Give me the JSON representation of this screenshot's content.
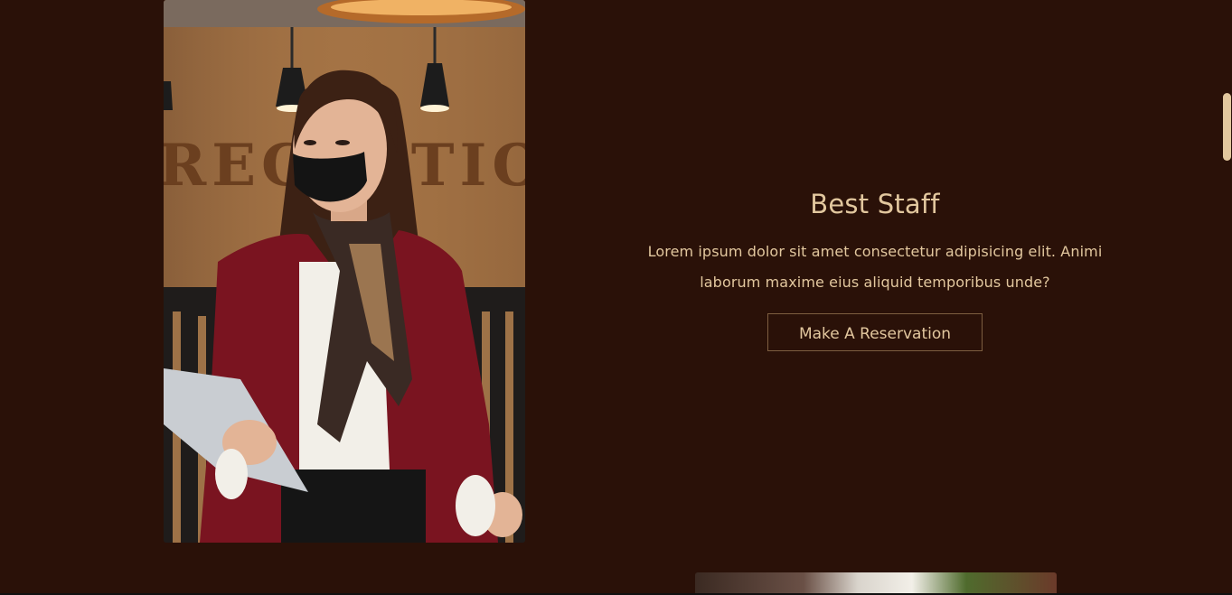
{
  "feature": {
    "title": "Best Staff",
    "description": "Lorem ipsum dolor sit amet consectetur adipisicing elit. Animi laborum maxime eius aliquid temporibus unde?",
    "button_label": "Make A Reservation",
    "photo_sign_text": "RECEPTION"
  },
  "colors": {
    "background": "#2a1108",
    "accent": "#e2c79e",
    "button_border": "#7d5e40"
  },
  "icons": {
    "scrollbar": "scrollbar-thumb"
  }
}
